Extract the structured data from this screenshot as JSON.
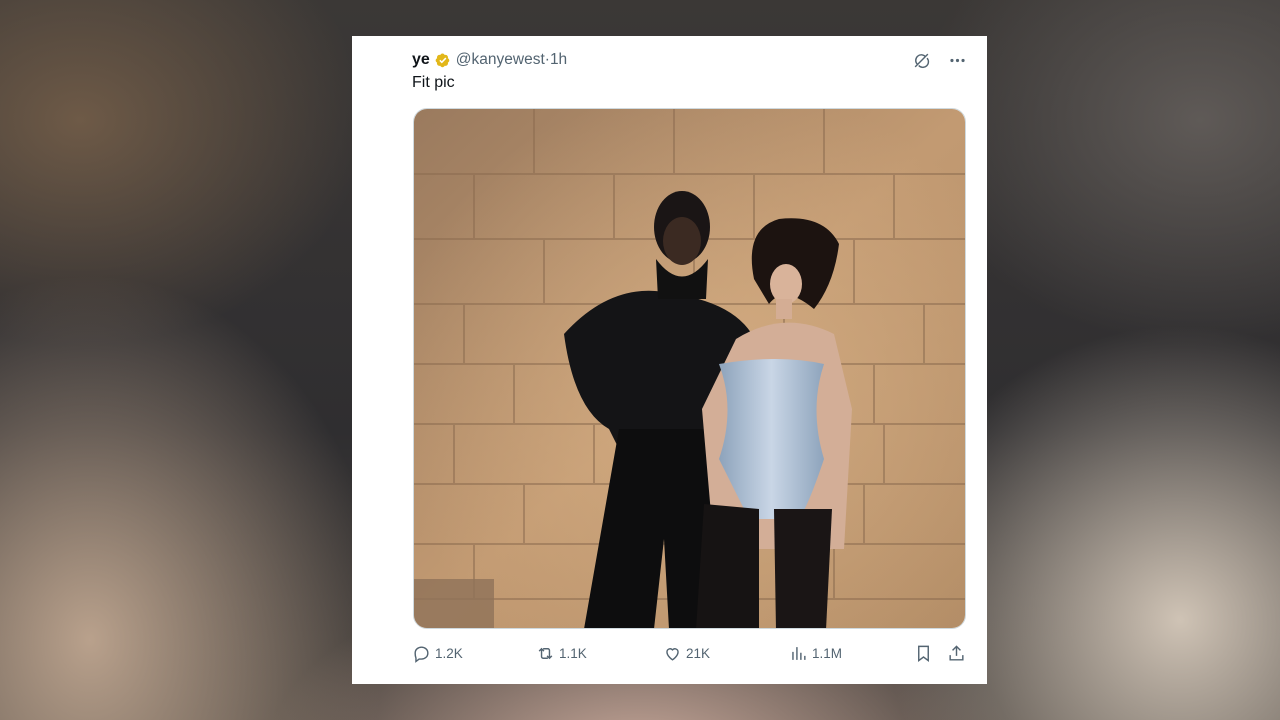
{
  "post": {
    "display_name": "ye",
    "handle": "@kanyewest",
    "separator": " · ",
    "time": "1h",
    "text": "Fit pic",
    "verified_color": "#e2b719"
  },
  "actions": {
    "replies": "1.2K",
    "reposts": "1.1K",
    "likes": "21K",
    "views": "1.1M"
  },
  "icons": [
    "grok-icon",
    "more-icon",
    "reply-icon",
    "repost-icon",
    "like-icon",
    "views-icon",
    "bookmark-icon",
    "share-icon"
  ],
  "colors": {
    "text": "#0f1419",
    "secondary": "#536471"
  }
}
